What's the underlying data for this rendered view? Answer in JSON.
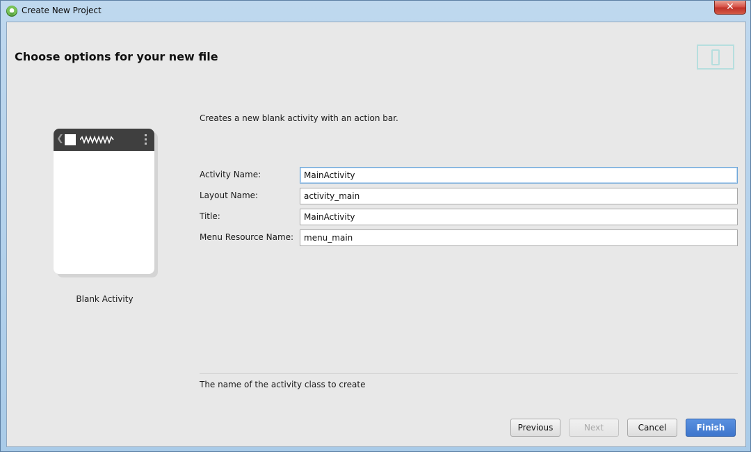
{
  "window": {
    "title": "Create New Project",
    "close_label": "✕"
  },
  "header": {
    "title": "Choose options for your new file"
  },
  "template": {
    "name": "Blank Activity",
    "description": "Creates a new blank activity with an action bar.",
    "back_glyph": "❮"
  },
  "form": {
    "fields": [
      {
        "label": "Activity Name:",
        "value": "MainActivity"
      },
      {
        "label": "Layout Name:",
        "value": "activity_main"
      },
      {
        "label": "Title:",
        "value": "MainActivity"
      },
      {
        "label": "Menu Resource Name:",
        "value": "menu_main"
      }
    ],
    "hint": "The name of the activity class to create"
  },
  "buttons": {
    "previous": "Previous",
    "next": "Next",
    "cancel": "Cancel",
    "finish": "Finish"
  },
  "colors": {
    "client_background": "#e8e8e8",
    "primary_button": "#3d75cc",
    "focus_border": "#6ea6d8",
    "device_icon": "#b6dede"
  }
}
